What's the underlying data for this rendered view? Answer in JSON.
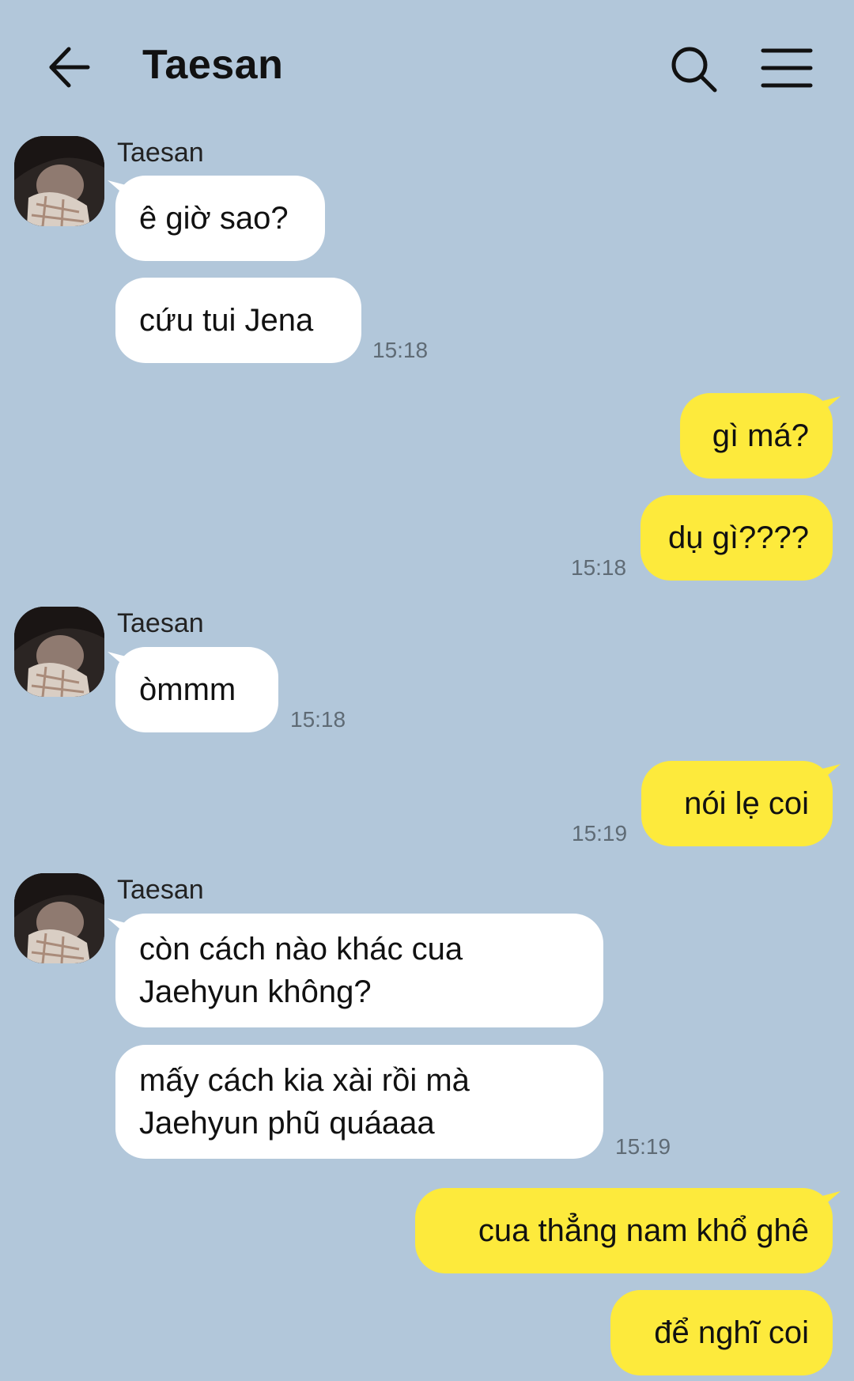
{
  "header": {
    "title": "Taesan",
    "back_icon": "arrow-left-icon",
    "search_icon": "search-icon",
    "menu_icon": "menu-icon"
  },
  "colors": {
    "background": "#b2c7da",
    "incoming_bubble": "#ffffff",
    "outgoing_bubble": "#fdea3c",
    "time_text": "#5f6b75"
  },
  "messages": {
    "g1": {
      "sender": "Taesan",
      "m1": "ê giờ sao?",
      "m2": "cứu tui Jena",
      "time": "15:18"
    },
    "g2": {
      "m1": "gì má?",
      "m2": "dụ gì????",
      "time": "15:18"
    },
    "g3": {
      "sender": "Taesan",
      "m1": "òmmm",
      "time": "15:18"
    },
    "g4": {
      "m1": "nói lẹ coi",
      "time": "15:19"
    },
    "g5": {
      "sender": "Taesan",
      "m1": "còn cách nào khác cua Jaehyun không?",
      "m2": "mấy cách kia xài rồi mà Jaehyun phũ quáaaa",
      "time": "15:19"
    },
    "g6": {
      "m1": "cua thẳng nam khổ ghê",
      "m2": "để nghĩ coi"
    }
  }
}
